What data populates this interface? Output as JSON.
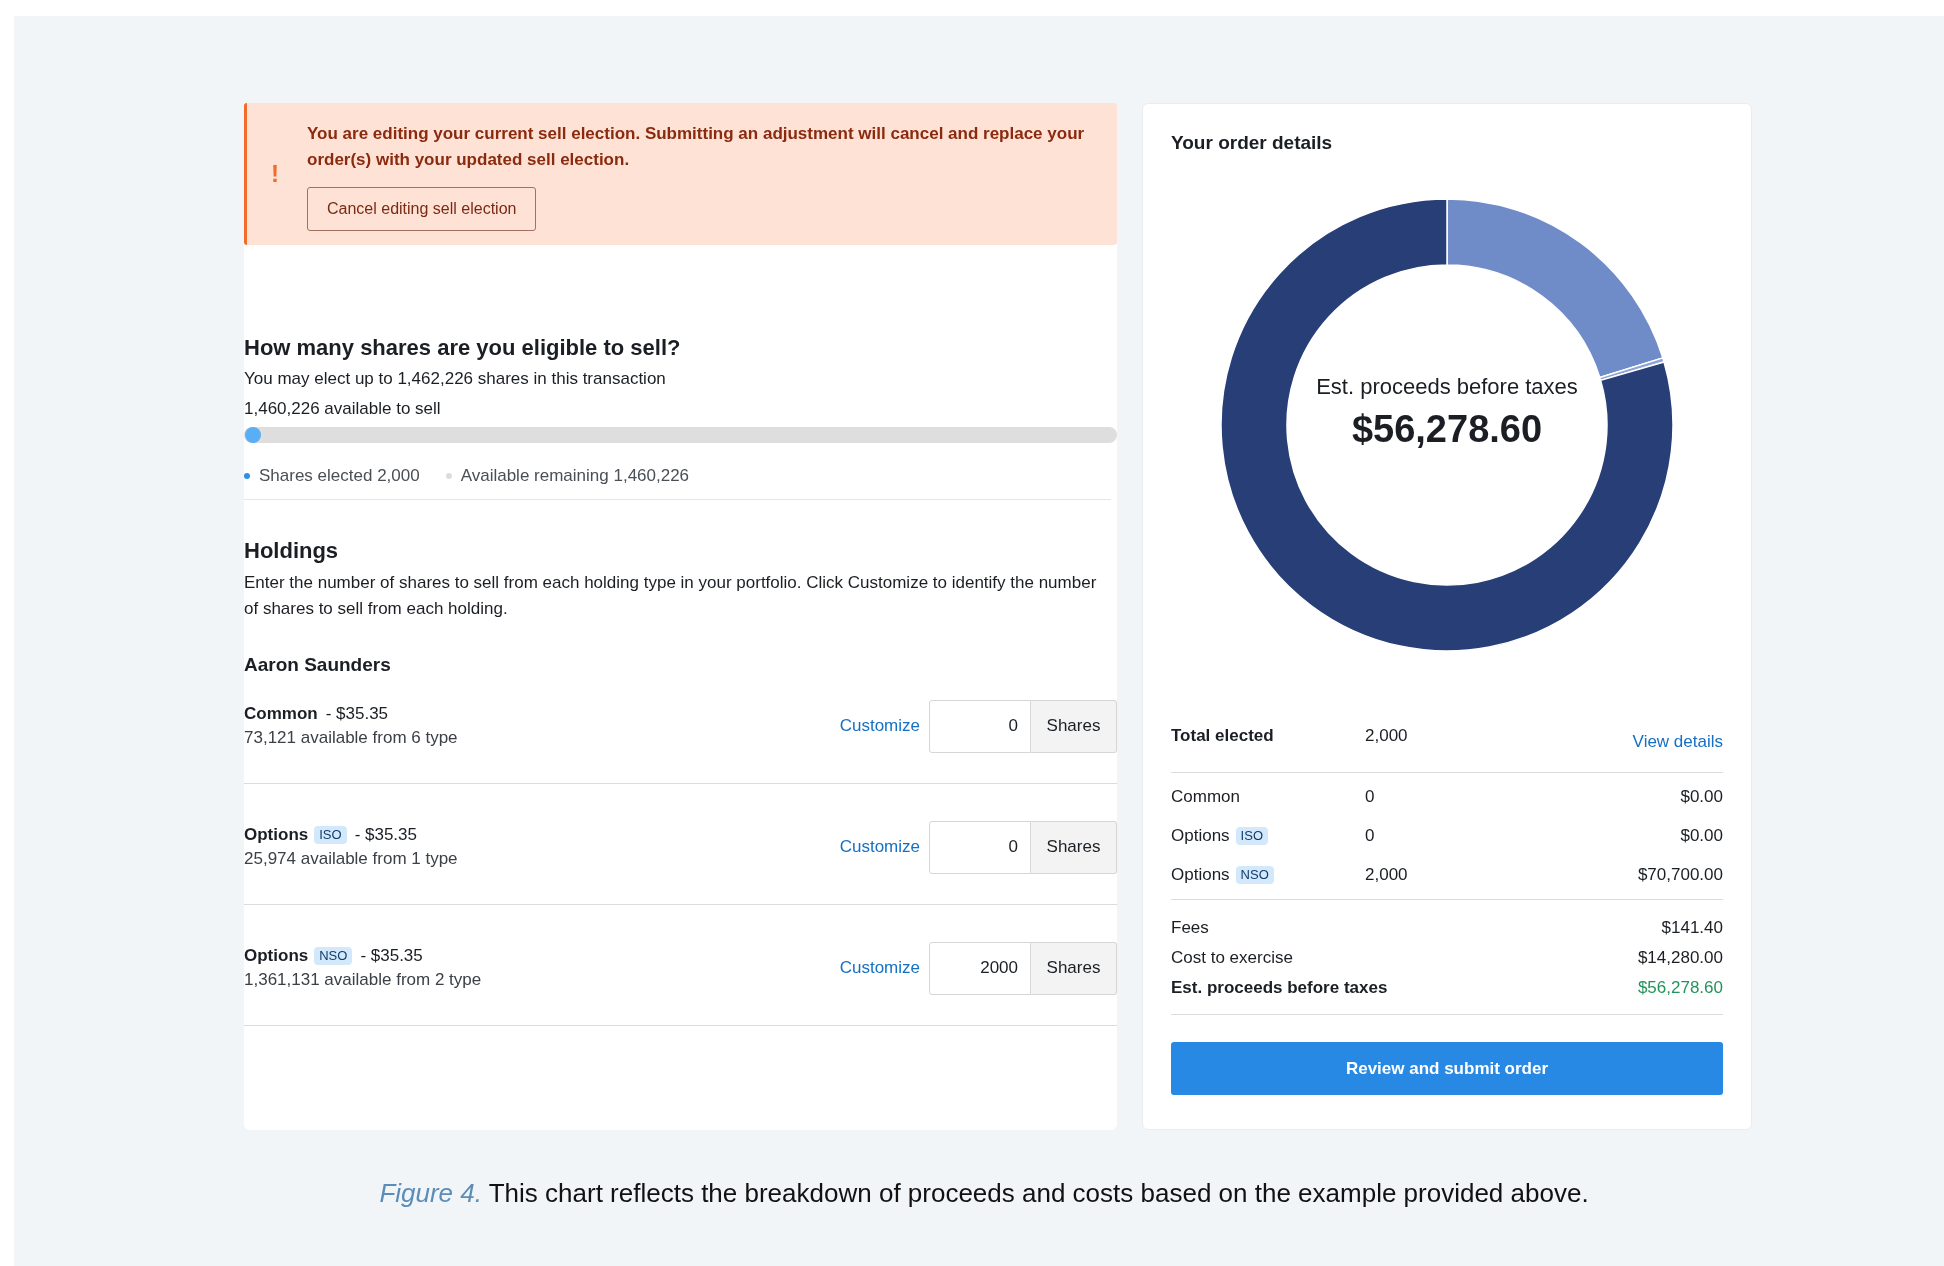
{
  "alert": {
    "message": "You are editing your current sell election. Submitting an adjustment will cancel and replace your order(s) with your updated sell election.",
    "icon": "!",
    "button": "Cancel editing sell election"
  },
  "eligibility": {
    "title": "How many shares are you eligible to sell?",
    "limit_text": "You may elect up to 1,462,226 shares in this transaction",
    "available": "1,460,226 available to sell",
    "slider": {
      "level": 0.0014
    },
    "legend": [
      {
        "label": "Shares elected 2,000",
        "color": "#2d8fe6"
      },
      {
        "label": "Available remaining 1,460,226",
        "color": "#dcdcdc"
      }
    ]
  },
  "holdings": {
    "title": "Holdings",
    "description": "Enter the number of shares to sell from each holding type in your portfolio. Click Customize to identify the number of shares to sell from each holding.",
    "owner": "Aaron Saunders",
    "rows": [
      {
        "type": "Common",
        "price": "- $35.35",
        "availability": "73,121 available from 6 type",
        "link": "Customize",
        "value": "0",
        "unit": "Shares"
      },
      {
        "type": "Options",
        "tag": "ISO",
        "price": "- $35.35",
        "availability": "25,974 available from 1 type",
        "link": "Customize",
        "value": "0",
        "unit": "Shares"
      },
      {
        "type": "Options",
        "tag": "NSO",
        "price": "- $35.35",
        "availability": "1,361,131 available from 2 type",
        "link": "Customize",
        "value": "2000",
        "unit": "Shares"
      }
    ]
  },
  "order": {
    "title": "Your order details",
    "donut": {
      "center_label": "Est. proceeds before taxes",
      "center_value": "$56,278.60"
    },
    "total": {
      "label": "Total elected",
      "value": "2,000",
      "link": "View details"
    },
    "lines": [
      {
        "label": "Common",
        "shares": "0",
        "amount": "$0.00"
      },
      {
        "label": "Options",
        "tag": "ISO",
        "shares": "0",
        "amount": "$0.00"
      },
      {
        "label": "Options",
        "tag": "NSO",
        "shares": "2,000",
        "amount": "$70,700.00"
      }
    ],
    "summary": [
      {
        "kind": "plain",
        "label": "Fees",
        "value": "$141.40"
      },
      {
        "kind": "plain",
        "label": "Cost to exercise",
        "value": "$14,280.00"
      },
      {
        "kind": "total",
        "label": "Est. proceeds before taxes",
        "value": "$56,278.60"
      }
    ],
    "button": "Review and submit order"
  },
  "caption": {
    "figure": "Figure 4.",
    "text": "This chart reflects the breakdown of proceeds and costs based on the example provided above."
  }
}
